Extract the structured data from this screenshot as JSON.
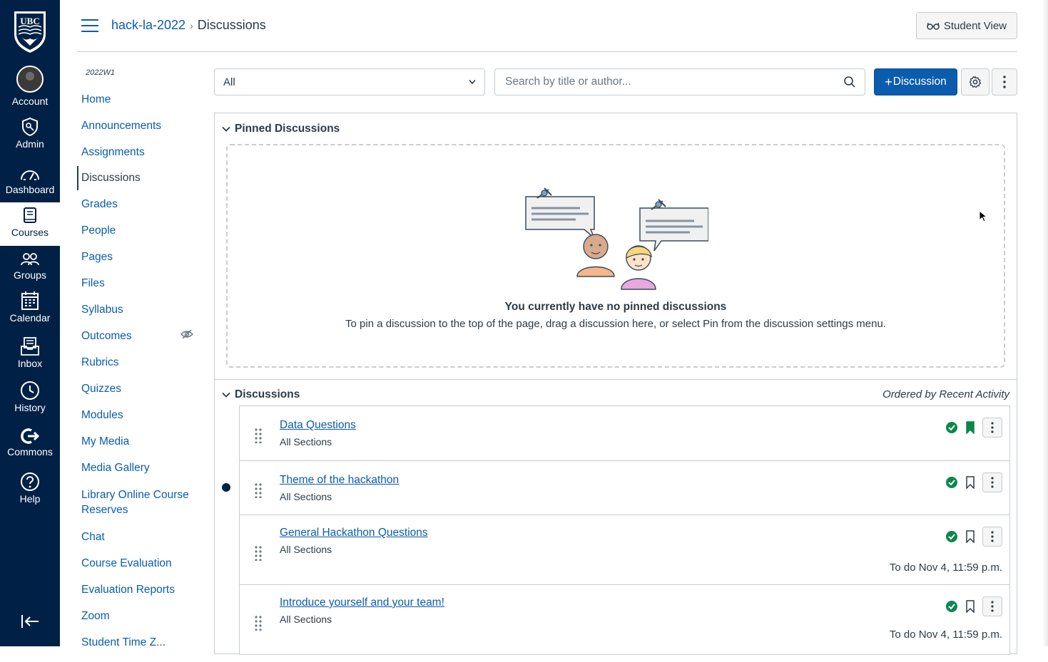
{
  "global_nav": {
    "logo_text": "UBC",
    "items": [
      {
        "label": "Account",
        "icon": "avatar"
      },
      {
        "label": "Admin",
        "icon": "shield-icon"
      },
      {
        "label": "Dashboard",
        "icon": "speedometer-icon"
      },
      {
        "label": "Courses",
        "icon": "book-icon"
      },
      {
        "label": "Groups",
        "icon": "group-icon"
      },
      {
        "label": "Calendar",
        "icon": "calendar-icon"
      },
      {
        "label": "Inbox",
        "icon": "inbox-icon"
      },
      {
        "label": "History",
        "icon": "clock-icon"
      },
      {
        "label": "Commons",
        "icon": "commons-icon"
      },
      {
        "label": "Help",
        "icon": "help-icon"
      }
    ],
    "collapse_icon": "collapse-icon"
  },
  "header": {
    "breadcrumb": [
      "hack-la-2022",
      "Discussions"
    ],
    "student_view_label": "Student View"
  },
  "course_nav": {
    "term": "2022W1",
    "items": [
      {
        "label": "Home"
      },
      {
        "label": "Announcements"
      },
      {
        "label": "Assignments"
      },
      {
        "label": "Discussions",
        "active": true
      },
      {
        "label": "Grades"
      },
      {
        "label": "People"
      },
      {
        "label": "Pages"
      },
      {
        "label": "Files"
      },
      {
        "label": "Syllabus"
      },
      {
        "label": "Outcomes",
        "hidden_icon": "eye-slash-icon"
      },
      {
        "label": "Rubrics"
      },
      {
        "label": "Quizzes"
      },
      {
        "label": "Modules"
      },
      {
        "label": "My Media"
      },
      {
        "label": "Media Gallery"
      },
      {
        "label": "Library Online Course Reserves"
      },
      {
        "label": "Chat"
      },
      {
        "label": "Course Evaluation"
      },
      {
        "label": "Evaluation Reports"
      },
      {
        "label": "Zoom"
      },
      {
        "label": "Student Time Z..."
      }
    ]
  },
  "toolbar": {
    "filter_value": "All",
    "search_placeholder": "Search by title or author...",
    "add_discussion_label": "Discussion"
  },
  "pinned": {
    "heading": "Pinned Discussions",
    "empty_title": "You currently have no pinned discussions",
    "empty_desc": "To pin a discussion to the top of the page, drag a discussion here, or select Pin from the discussion settings menu."
  },
  "discussions": {
    "heading": "Discussions",
    "ordered_by": "Ordered by Recent Activity",
    "rows": [
      {
        "title": "Data Questions",
        "sections": "All Sections",
        "published": true,
        "subscribed": true,
        "unread": false,
        "todo": ""
      },
      {
        "title": "Theme of the hackathon",
        "sections": "All Sections",
        "published": true,
        "subscribed": false,
        "unread": true,
        "todo": ""
      },
      {
        "title": "General Hackathon Questions",
        "sections": "All Sections",
        "published": true,
        "subscribed": false,
        "unread": false,
        "todo": "To do Nov 4, 11:59 p.m."
      },
      {
        "title": "Introduce yourself and your team!",
        "sections": "All Sections",
        "published": true,
        "subscribed": false,
        "unread": false,
        "todo": "To do Nov 4, 11:59 p.m."
      }
    ]
  },
  "colors": {
    "nav_bg": "#002145",
    "link": "#0b5cad",
    "primary_button": "#0b5cad",
    "published_green": "#0b874b"
  }
}
